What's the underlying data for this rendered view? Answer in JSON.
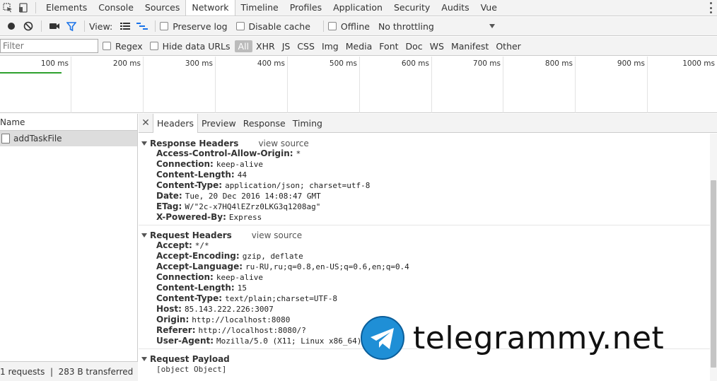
{
  "main_tabs": [
    "Elements",
    "Console",
    "Sources",
    "Network",
    "Timeline",
    "Profiles",
    "Application",
    "Security",
    "Audits",
    "Vue"
  ],
  "active_tab": "Network",
  "toolbar": {
    "view_label": "View:",
    "preserve_log": "Preserve log",
    "disable_cache": "Disable cache",
    "offline": "Offline",
    "throttling": "No throttling"
  },
  "filterbar": {
    "placeholder": "Filter",
    "regex": "Regex",
    "hide_data_urls": "Hide data URLs",
    "types": [
      "All",
      "XHR",
      "JS",
      "CSS",
      "Img",
      "Media",
      "Font",
      "Doc",
      "WS",
      "Manifest",
      "Other"
    ]
  },
  "timeline": {
    "ticks": [
      "100 ms",
      "200 ms",
      "300 ms",
      "400 ms",
      "500 ms",
      "600 ms",
      "700 ms",
      "800 ms",
      "900 ms",
      "1000 ms"
    ]
  },
  "request_list": {
    "header": "Name",
    "rows": [
      "addTaskFile"
    ],
    "footer": "1 requests  |  283 B transferred"
  },
  "detail": {
    "tabs": [
      "Headers",
      "Preview",
      "Response",
      "Timing"
    ],
    "active_tab": "Headers",
    "response_headers": {
      "title": "Response Headers",
      "view_source": "view source",
      "rows": [
        {
          "name": "Access-Control-Allow-Origin:",
          "value": "*"
        },
        {
          "name": "Connection:",
          "value": "keep-alive"
        },
        {
          "name": "Content-Length:",
          "value": "44"
        },
        {
          "name": "Content-Type:",
          "value": "application/json; charset=utf-8"
        },
        {
          "name": "Date:",
          "value": "Tue, 20 Dec 2016 14:08:47 GMT"
        },
        {
          "name": "ETag:",
          "value": "W/\"2c-x7HQ4lEZrz0LKG3q1208ag\""
        },
        {
          "name": "X-Powered-By:",
          "value": "Express"
        }
      ]
    },
    "request_headers": {
      "title": "Request Headers",
      "view_source": "view source",
      "rows": [
        {
          "name": "Accept:",
          "value": "*/*"
        },
        {
          "name": "Accept-Encoding:",
          "value": "gzip, deflate"
        },
        {
          "name": "Accept-Language:",
          "value": "ru-RU,ru;q=0.8,en-US;q=0.6,en;q=0.4"
        },
        {
          "name": "Connection:",
          "value": "keep-alive"
        },
        {
          "name": "Content-Length:",
          "value": "15"
        },
        {
          "name": "Content-Type:",
          "value": "text/plain;charset=UTF-8"
        },
        {
          "name": "Host:",
          "value": "85.143.222.226:3007"
        },
        {
          "name": "Origin:",
          "value": "http://localhost:8080"
        },
        {
          "name": "Referer:",
          "value": "http://localhost:8080/?"
        },
        {
          "name": "User-Agent:",
          "value": "Mozilla/5.0 (X11; Linux x86_64) A"
        }
      ]
    },
    "request_payload": {
      "title": "Request Payload",
      "value": "[object Object]"
    }
  },
  "watermark": "telegrammy.net",
  "colors": {
    "toolbar_bg": "#f3f3f3",
    "filter_active": "#1a73e8",
    "timeline_bar": "#2ea02e",
    "selected_row": "#dddddd"
  }
}
